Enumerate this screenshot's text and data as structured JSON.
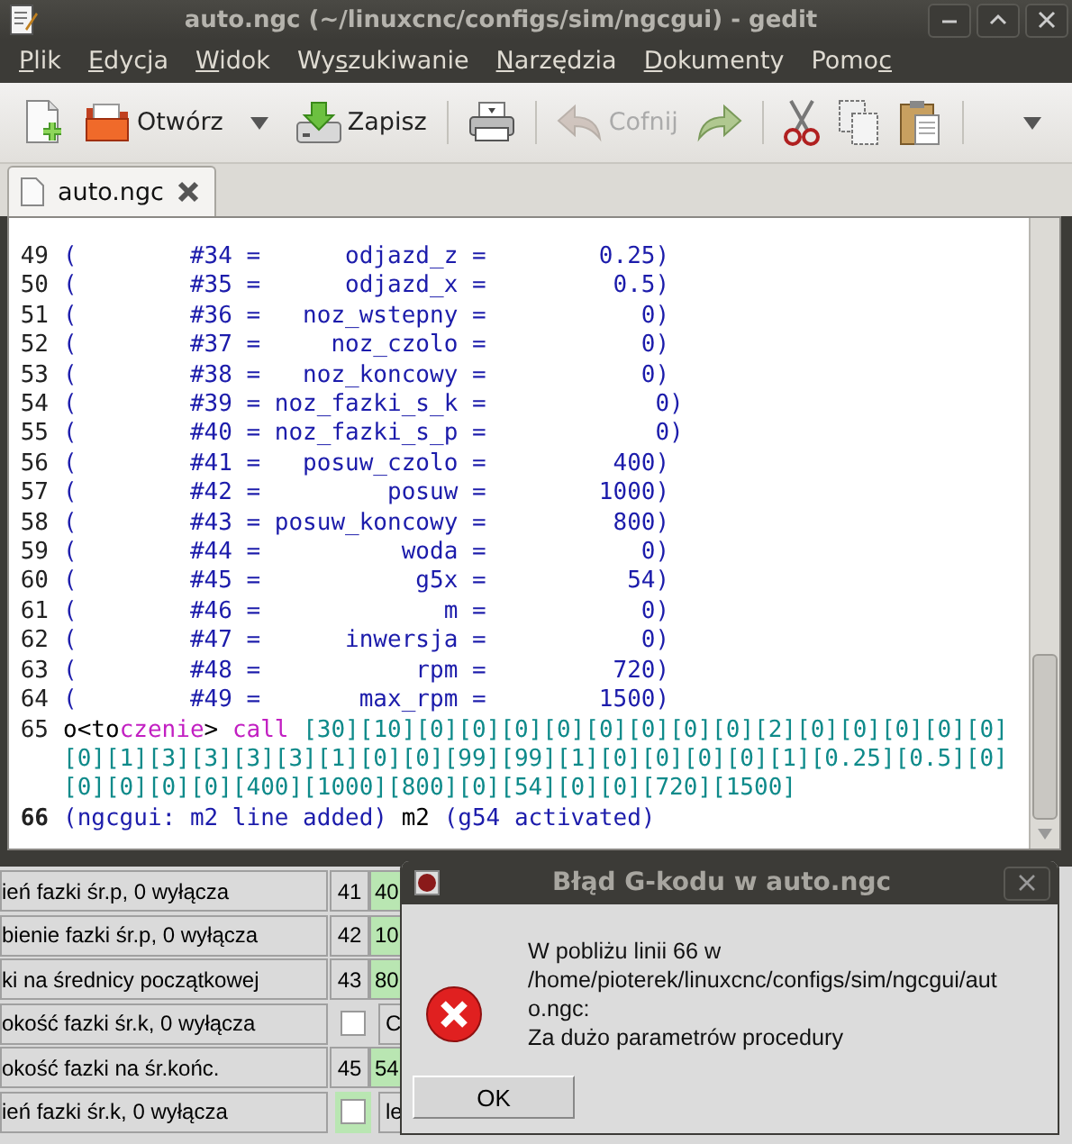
{
  "window": {
    "title": "auto.ngc (~/linuxcnc/configs/sim/ngcgui) - gedit"
  },
  "menu": [
    {
      "key": "P",
      "after": "lik"
    },
    {
      "key": "E",
      "after": "dycja"
    },
    {
      "key": "W",
      "after": "idok"
    },
    {
      "before": "Wy",
      "key": "s",
      "after": "zukiwanie"
    },
    {
      "key": "N",
      "after": "arzędzia"
    },
    {
      "key": "D",
      "after": "okumenty"
    },
    {
      "before": "Pomo",
      "key": "c"
    }
  ],
  "toolbar": [
    {
      "kind": "new"
    },
    {
      "kind": "open",
      "label": "Otwórz"
    },
    {
      "kind": "dropdown"
    },
    {
      "kind": "save",
      "label": "Zapisz"
    },
    {
      "kind": "separator"
    },
    {
      "kind": "print"
    },
    {
      "kind": "separator"
    },
    {
      "kind": "undo",
      "label": "Cofnij",
      "disabled": true
    },
    {
      "kind": "redo",
      "disabled": false
    },
    {
      "kind": "separator"
    },
    {
      "kind": "cut"
    },
    {
      "kind": "copy"
    },
    {
      "kind": "paste"
    },
    {
      "kind": "separator"
    },
    {
      "kind": "overflow"
    }
  ],
  "tabs": [
    {
      "label": "auto.ngc",
      "selected": true
    }
  ],
  "editor": {
    "lines": [
      {
        "number": "49",
        "current": false,
        "rows": [
          [
            {
              "kind": "comment",
              "text": "(        #34 =      odjazd_z =        0.25)"
            }
          ]
        ]
      },
      {
        "number": "50",
        "current": false,
        "rows": [
          [
            {
              "kind": "comment",
              "text": "(        #35 =      odjazd_x =         0.5)"
            }
          ]
        ]
      },
      {
        "number": "51",
        "current": false,
        "rows": [
          [
            {
              "kind": "comment",
              "text": "(        #36 =   noz_wstepny =           0)"
            }
          ]
        ]
      },
      {
        "number": "52",
        "current": false,
        "rows": [
          [
            {
              "kind": "comment",
              "text": "(        #37 =     noz_czolo =           0)"
            }
          ]
        ]
      },
      {
        "number": "53",
        "current": false,
        "rows": [
          [
            {
              "kind": "comment",
              "text": "(        #38 =   noz_koncowy =           0)"
            }
          ]
        ]
      },
      {
        "number": "54",
        "current": false,
        "rows": [
          [
            {
              "kind": "comment",
              "text": "(        #39 = noz_fazki_s_k =            0)"
            }
          ]
        ]
      },
      {
        "number": "55",
        "current": false,
        "rows": [
          [
            {
              "kind": "comment",
              "text": "(        #40 = noz_fazki_s_p =            0)"
            }
          ]
        ]
      },
      {
        "number": "56",
        "current": false,
        "rows": [
          [
            {
              "kind": "comment",
              "text": "(        #41 =   posuw_czolo =         400)"
            }
          ]
        ]
      },
      {
        "number": "57",
        "current": false,
        "rows": [
          [
            {
              "kind": "comment",
              "text": "(        #42 =         posuw =        1000)"
            }
          ]
        ]
      },
      {
        "number": "58",
        "current": false,
        "rows": [
          [
            {
              "kind": "comment",
              "text": "(        #43 = posuw_koncowy =         800)"
            }
          ]
        ]
      },
      {
        "number": "59",
        "current": false,
        "rows": [
          [
            {
              "kind": "comment",
              "text": "(        #44 =          woda =           0)"
            }
          ]
        ]
      },
      {
        "number": "60",
        "current": false,
        "rows": [
          [
            {
              "kind": "comment",
              "text": "(        #45 =           g5x =          54)"
            }
          ]
        ]
      },
      {
        "number": "61",
        "current": false,
        "rows": [
          [
            {
              "kind": "comment",
              "text": "(        #46 =             m =           0)"
            }
          ]
        ]
      },
      {
        "number": "62",
        "current": false,
        "rows": [
          [
            {
              "kind": "comment",
              "text": "(        #47 =      inwersja =           0)"
            }
          ]
        ]
      },
      {
        "number": "63",
        "current": false,
        "rows": [
          [
            {
              "kind": "comment",
              "text": "(        #48 =           rpm =         720)"
            }
          ]
        ]
      },
      {
        "number": "64",
        "current": false,
        "rows": [
          [
            {
              "kind": "comment",
              "text": "(        #49 =       max_rpm =        1500)"
            }
          ]
        ]
      },
      {
        "number": "65",
        "current": false,
        "rows": [
          [
            {
              "kind": "plain",
              "text": "o<to"
            },
            {
              "kind": "keyword",
              "text": "czenie"
            },
            {
              "kind": "plain",
              "text": "> "
            },
            {
              "kind": "keyword",
              "text": "call"
            },
            {
              "kind": "plain",
              "text": " "
            },
            {
              "kind": "number",
              "text": "[30][10][0][0][0][0][0][0][0][0][2][0][0][0][0][0]"
            }
          ],
          [
            {
              "kind": "number",
              "text": "[0][1][3][3][3][3][1][0][0][99][99][1][0][0][0][0][1][0.25][0.5][0]"
            }
          ],
          [
            {
              "kind": "number",
              "text": "[0][0][0][0][400][1000][800][0][54][0][0][720][1500]"
            }
          ]
        ]
      },
      {
        "number": "66",
        "current": true,
        "rows": [
          [
            {
              "kind": "comment",
              "text": "(ngcgui: m2 line added)"
            },
            {
              "kind": "plain",
              "text": " m2 "
            },
            {
              "kind": "comment",
              "text": "(g54 activated)"
            }
          ]
        ]
      }
    ]
  },
  "form_rows": [
    {
      "label": "ień fazki śr.p, 0 wyłącza",
      "kind": "entry",
      "number": "41",
      "value": "40",
      "highlighted": true
    },
    {
      "label": "bienie fazki śr.p, 0 wyłącza",
      "kind": "entry",
      "number": "42",
      "value": "10",
      "highlighted": true
    },
    {
      "label": "ki na średnicy początkowej",
      "kind": "entry",
      "number": "43",
      "value": "80",
      "highlighted": true
    },
    {
      "label": "okość fazki śr.k, 0 wyłącza",
      "kind": "checkbox",
      "checked": false,
      "value": "C",
      "highlighted": false
    },
    {
      "label": "okość fazki na śr.końc.",
      "kind": "entry",
      "number": "45",
      "value": "54",
      "highlighted": true
    },
    {
      "label": "ień fazki śr.k, 0 wyłącza",
      "kind": "checkbox",
      "checked": false,
      "value": "le",
      "highlighted": true
    }
  ],
  "dialog": {
    "title": "Błąd G-kodu w auto.ngc",
    "message": [
      "W pobliżu linii 66 w",
      "/home/pioterek/linuxcnc/configs/sim/ngcgui/aut",
      "o.ngc:",
      "Za dużo parametrów procedury"
    ],
    "button": "OK"
  }
}
